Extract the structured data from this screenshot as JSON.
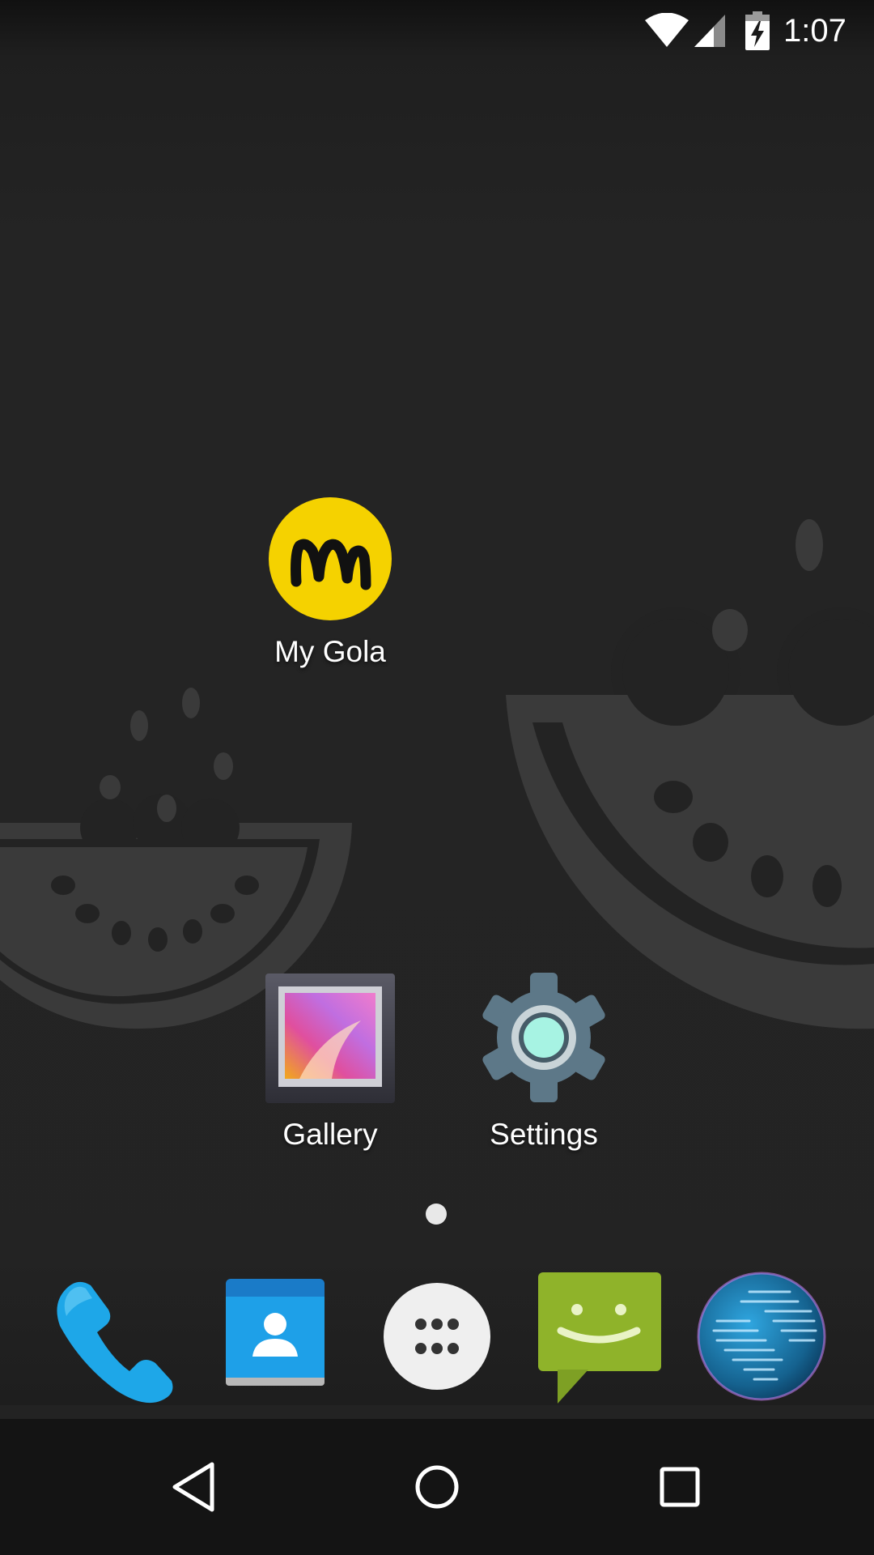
{
  "status_bar": {
    "time": "1:07",
    "icons": [
      "wifi-icon",
      "cell-signal-icon",
      "battery-charging-icon"
    ]
  },
  "home_screen": {
    "apps": [
      {
        "label": "My Gola",
        "icon": "mygola-logo-icon"
      },
      {
        "label": "Gallery",
        "icon": "gallery-icon"
      },
      {
        "label": "Settings",
        "icon": "settings-gear-icon"
      }
    ],
    "page_count": 1,
    "current_page": 1
  },
  "dock": {
    "items": [
      "phone-icon",
      "contacts-icon",
      "all-apps-icon",
      "messaging-icon",
      "browser-globe-icon"
    ]
  },
  "nav_bar": {
    "buttons": [
      "back-icon",
      "home-icon",
      "recents-icon"
    ]
  },
  "colors": {
    "background": "#232323",
    "wallpaper_shapes": "#3a3a3a",
    "mygola_yellow": "#f5d200",
    "phone_blue": "#1ea7e8",
    "messaging_green": "#8fb32a",
    "settings_teal": "#a7f3e3"
  }
}
